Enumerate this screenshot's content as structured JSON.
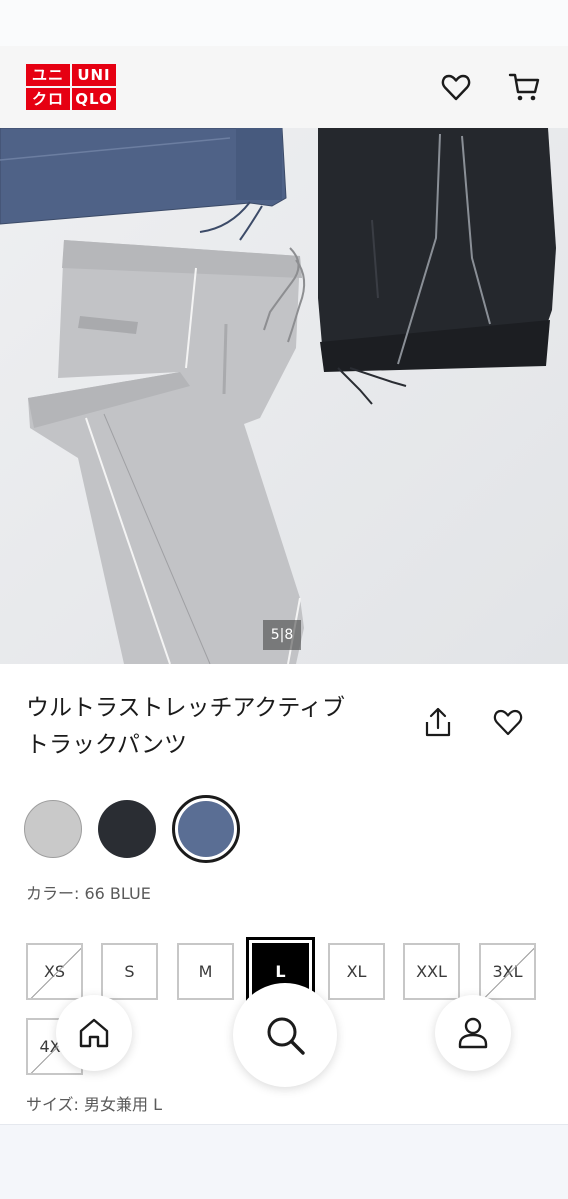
{
  "header": {
    "logo": [
      "ユニ",
      "UNI",
      "クロ",
      "QLO"
    ],
    "icons": [
      "heart-icon",
      "cart-icon"
    ]
  },
  "gallery": {
    "counter": "5|8"
  },
  "product": {
    "title_line1": "ウルトラストレッチアクティブ",
    "title_line2": "トラックパンツ"
  },
  "colors": {
    "swatches": [
      "#c9c9c9",
      "#2a2d33",
      "#5a6e94"
    ],
    "selected_index": 2,
    "label": "カラー: 66 BLUE"
  },
  "sizes": {
    "options": [
      "XS",
      "S",
      "M",
      "L",
      "XL",
      "XXL",
      "3XL",
      "4XL"
    ],
    "unavailable": [
      "XS",
      "3XL",
      "4XL"
    ],
    "selected": "L",
    "label": "サイズ: 男女兼用 L"
  },
  "nav": {
    "icons": [
      "home-icon",
      "search-icon",
      "user-icon"
    ]
  }
}
